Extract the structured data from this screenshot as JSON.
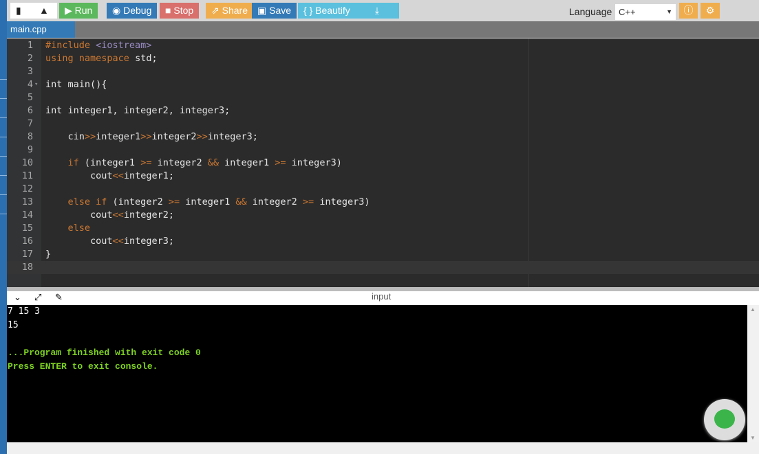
{
  "toolbar": {
    "run": "Run",
    "debug": "Debug",
    "stop": "Stop",
    "share": "Share",
    "save": "Save",
    "beautify": "{ } Beautify",
    "language_label": "Language",
    "language_value": "C++"
  },
  "tabs": [
    {
      "label": "main.cpp"
    }
  ],
  "code": [
    [
      [
        "#include ",
        "kw"
      ],
      [
        "<iostream>",
        "str"
      ]
    ],
    [
      [
        "using ",
        "kw"
      ],
      [
        "namespace ",
        "kw"
      ],
      [
        "std;",
        ""
      ]
    ],
    [],
    [
      [
        "int main(){",
        ""
      ]
    ],
    [],
    [
      [
        "int integer1, integer2, integer3;",
        ""
      ]
    ],
    [],
    [
      [
        "    cin",
        ""
      ],
      [
        ">>",
        "op"
      ],
      [
        "integer1",
        ""
      ],
      [
        ">>",
        "op"
      ],
      [
        "integer2",
        ""
      ],
      [
        ">>",
        "op"
      ],
      [
        "integer3;",
        ""
      ]
    ],
    [],
    [
      [
        "    ",
        ""
      ],
      [
        "if ",
        "kw"
      ],
      [
        "(integer1 ",
        ""
      ],
      [
        ">=",
        "op"
      ],
      [
        " integer2 ",
        ""
      ],
      [
        "&&",
        "op"
      ],
      [
        " integer1 ",
        ""
      ],
      [
        ">=",
        "op"
      ],
      [
        " integer3)",
        ""
      ]
    ],
    [
      [
        "        cout",
        ""
      ],
      [
        "<<",
        "op"
      ],
      [
        "integer1;",
        ""
      ]
    ],
    [],
    [
      [
        "    ",
        ""
      ],
      [
        "else if ",
        "kw"
      ],
      [
        "(integer2 ",
        ""
      ],
      [
        ">=",
        "op"
      ],
      [
        " integer1 ",
        ""
      ],
      [
        "&&",
        "op"
      ],
      [
        " integer2 ",
        ""
      ],
      [
        ">=",
        "op"
      ],
      [
        " integer3)",
        ""
      ]
    ],
    [
      [
        "        cout",
        ""
      ],
      [
        "<<",
        "op"
      ],
      [
        "integer2;",
        ""
      ]
    ],
    [
      [
        "    ",
        ""
      ],
      [
        "else",
        "kw"
      ]
    ],
    [
      [
        "        cout",
        ""
      ],
      [
        "<<",
        "op"
      ],
      [
        "integer3;",
        ""
      ]
    ],
    [
      [
        "}",
        ""
      ]
    ],
    []
  ],
  "console": {
    "title": "input",
    "lines": [
      "7 15 3",
      "15",
      "",
      "...Program finished with exit code 0",
      "Press ENTER to exit console."
    ]
  }
}
